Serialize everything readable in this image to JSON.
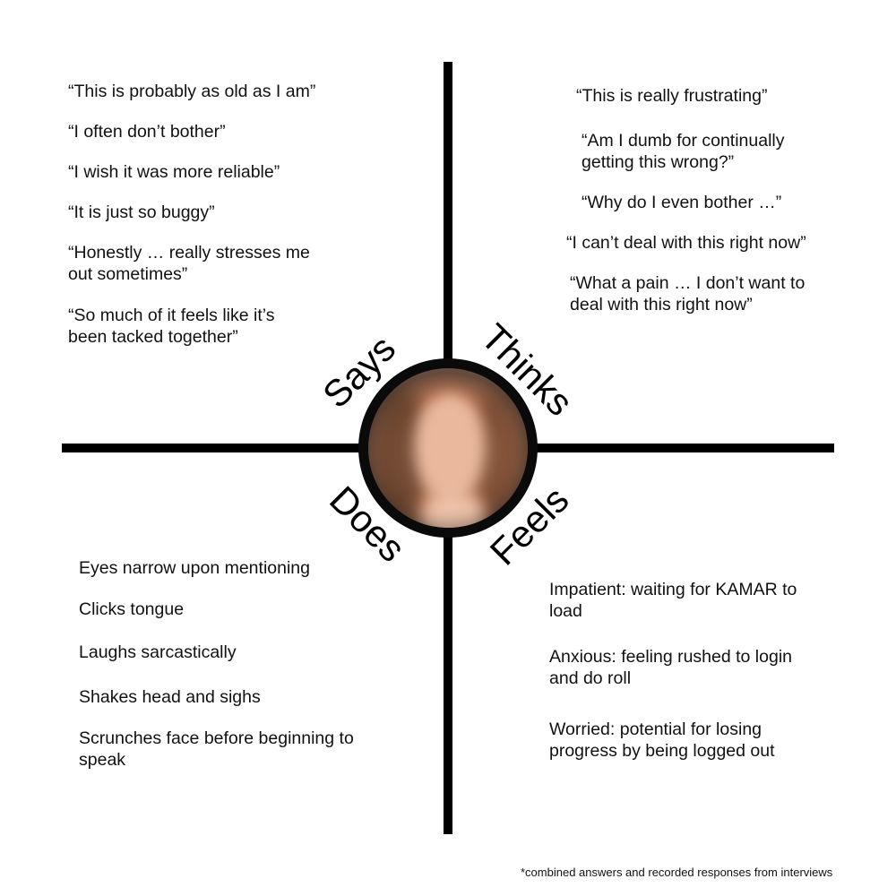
{
  "says": {
    "label": "Says",
    "items": [
      "“This is probably as old as I am”",
      "“I often don’t bother”",
      "“I wish it was more reliable”",
      "“It is just so buggy”",
      "“Honestly … really stresses me\nout sometimes”",
      "“So much of it feels like it’s\nbeen tacked together”"
    ]
  },
  "thinks": {
    "label": "Thinks",
    "items": [
      "“This is really frustrating”",
      "“Am I dumb for continually\ngetting this wrong?”",
      "“Why do I even bother …”",
      "“I can’t deal with this right now”",
      "“What a pain … I don’t want to\ndeal with this right now”"
    ]
  },
  "does": {
    "label": "Does",
    "items": [
      "Eyes narrow upon mentioning",
      "Clicks tongue",
      "Laughs sarcastically",
      "Shakes head and sighs",
      "Scrunches face before beginning to\nspeak"
    ]
  },
  "feels": {
    "label": "Feels",
    "items": [
      "Impatient: waiting for KAMAR to\nload",
      "Anxious: feeling rushed to login\nand do roll",
      "Worried: potential for losing\nprogress by being logged out"
    ]
  },
  "footnote": "*combined answers and recorded responses from interviews"
}
